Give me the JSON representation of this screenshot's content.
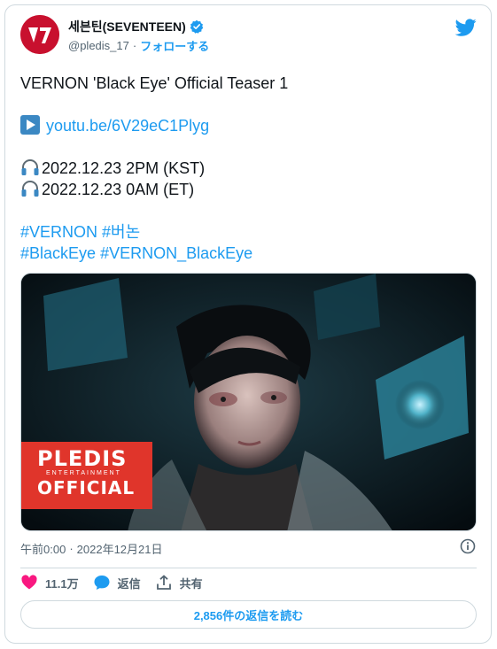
{
  "header": {
    "display_name": "세븐틴(SEVENTEEN)",
    "handle": "@pledis_17",
    "separator": "·",
    "follow_label": "フォローする"
  },
  "tweet": {
    "title_line": "VERNON 'Black Eye' Official Teaser 1",
    "link_text": "youtu.be/6V29eC1Plyg",
    "schedule": [
      "2022.12.23 2PM (KST)",
      "2022.12.23 0AM (ET)"
    ],
    "hashtags_line1": [
      "#VERNON",
      "#버논"
    ],
    "hashtags_line2": [
      "#BlackEye",
      "#VERNON_BlackEye"
    ]
  },
  "media": {
    "badge_main": "PLEDIS",
    "badge_sub": "ENTERTAINMENT",
    "badge_official": "OFFICIAL"
  },
  "meta": {
    "time": "午前0:00",
    "separator": "·",
    "date": "2022年12月21日"
  },
  "actions": {
    "likes": "11.1万",
    "reply_label": "返信",
    "share_label": "共有"
  },
  "replies_button": "2,856件の返信を読む",
  "colors": {
    "brand_blue": "#1d9bf0",
    "like_pink": "#f91880",
    "avatar_red": "#c8102e",
    "badge_red": "#e0352b"
  },
  "icons": [
    "verified-icon",
    "twitter-bird-icon",
    "play-button-icon",
    "headphones-icon",
    "info-icon",
    "heart-icon",
    "reply-bubble-icon",
    "share-icon"
  ]
}
